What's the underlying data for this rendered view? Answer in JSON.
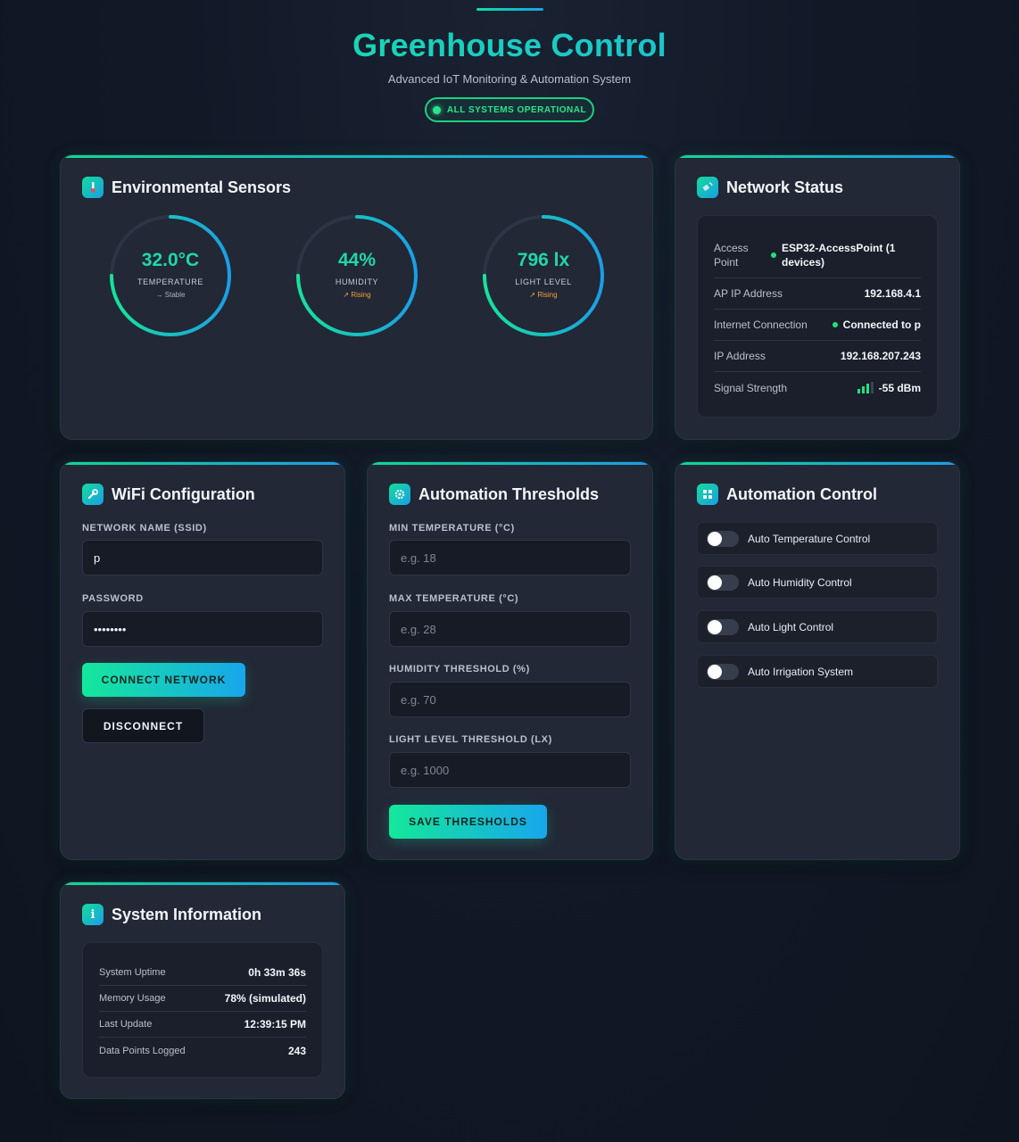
{
  "header": {
    "title": "Greenhouse Control",
    "subtitle": "Advanced IoT Monitoring & Automation System",
    "status": "ALL SYSTEMS OPERATIONAL"
  },
  "colors": {
    "accent_green": "#14e89a",
    "accent_blue": "#18a6ec",
    "status_green": "#22e07f",
    "trend_rising": "#f0a13a"
  },
  "sensors": {
    "title": "Environmental Sensors",
    "icon": "thermometer-icon",
    "gauges": [
      {
        "value": "32.0°C",
        "label": "TEMPERATURE",
        "trend": "→ Stable",
        "trend_type": "stable",
        "fill_fraction": 0.75
      },
      {
        "value": "44%",
        "label": "HUMIDITY",
        "trend": "↗ Rising",
        "trend_type": "rising",
        "fill_fraction": 0.75
      },
      {
        "value": "796 lx",
        "label": "LIGHT LEVEL",
        "trend": "↗ Rising",
        "trend_type": "rising",
        "fill_fraction": 0.75
      }
    ]
  },
  "network": {
    "title": "Network Status",
    "icon": "satellite-icon",
    "rows": [
      {
        "label": "Access Point",
        "value": "ESP32-AccessPoint (1 devices)"
      },
      {
        "label": "AP IP Address",
        "value": "192.168.4.1"
      },
      {
        "label": "Internet Connection",
        "value": "Connected to p"
      },
      {
        "label": "IP Address",
        "value": "192.168.207.243"
      },
      {
        "label": "Signal Strength",
        "value": "-55 dBm"
      }
    ]
  },
  "wifi": {
    "title": "WiFi Configuration",
    "icon": "wrench-icon",
    "ssid_label": "NETWORK NAME (SSID)",
    "ssid_value": "p",
    "password_label": "PASSWORD",
    "password_value": "••••••••",
    "connect_label": "CONNECT NETWORK",
    "disconnect_label": "DISCONNECT"
  },
  "thresholds": {
    "title": "Automation Thresholds",
    "icon": "gear-icon",
    "min_temp_label": "MIN TEMPERATURE (°C)",
    "min_temp_placeholder": "e.g. 18",
    "max_temp_label": "MAX TEMPERATURE (°C)",
    "max_temp_placeholder": "e.g. 28",
    "humidity_label": "HUMIDITY THRESHOLD (%)",
    "humidity_placeholder": "e.g. 70",
    "light_label": "LIGHT LEVEL THRESHOLD (LX)",
    "light_placeholder": "e.g. 1000",
    "save_label": "SAVE THRESHOLDS"
  },
  "automation": {
    "title": "Automation Control",
    "icon": "control-panel-icon",
    "toggles": [
      {
        "label": "Auto Temperature Control",
        "on": false
      },
      {
        "label": "Auto Humidity Control",
        "on": false
      },
      {
        "label": "Auto Light Control",
        "on": false
      },
      {
        "label": "Auto Irrigation System",
        "on": false
      }
    ]
  },
  "system": {
    "title": "System Information",
    "icon": "info-icon",
    "rows": [
      {
        "label": "System Uptime",
        "value": "0h 33m 36s"
      },
      {
        "label": "Memory Usage",
        "value": "78% (simulated)"
      },
      {
        "label": "Last Update",
        "value": "12:39:15 PM"
      },
      {
        "label": "Data Points Logged",
        "value": "243"
      }
    ]
  }
}
